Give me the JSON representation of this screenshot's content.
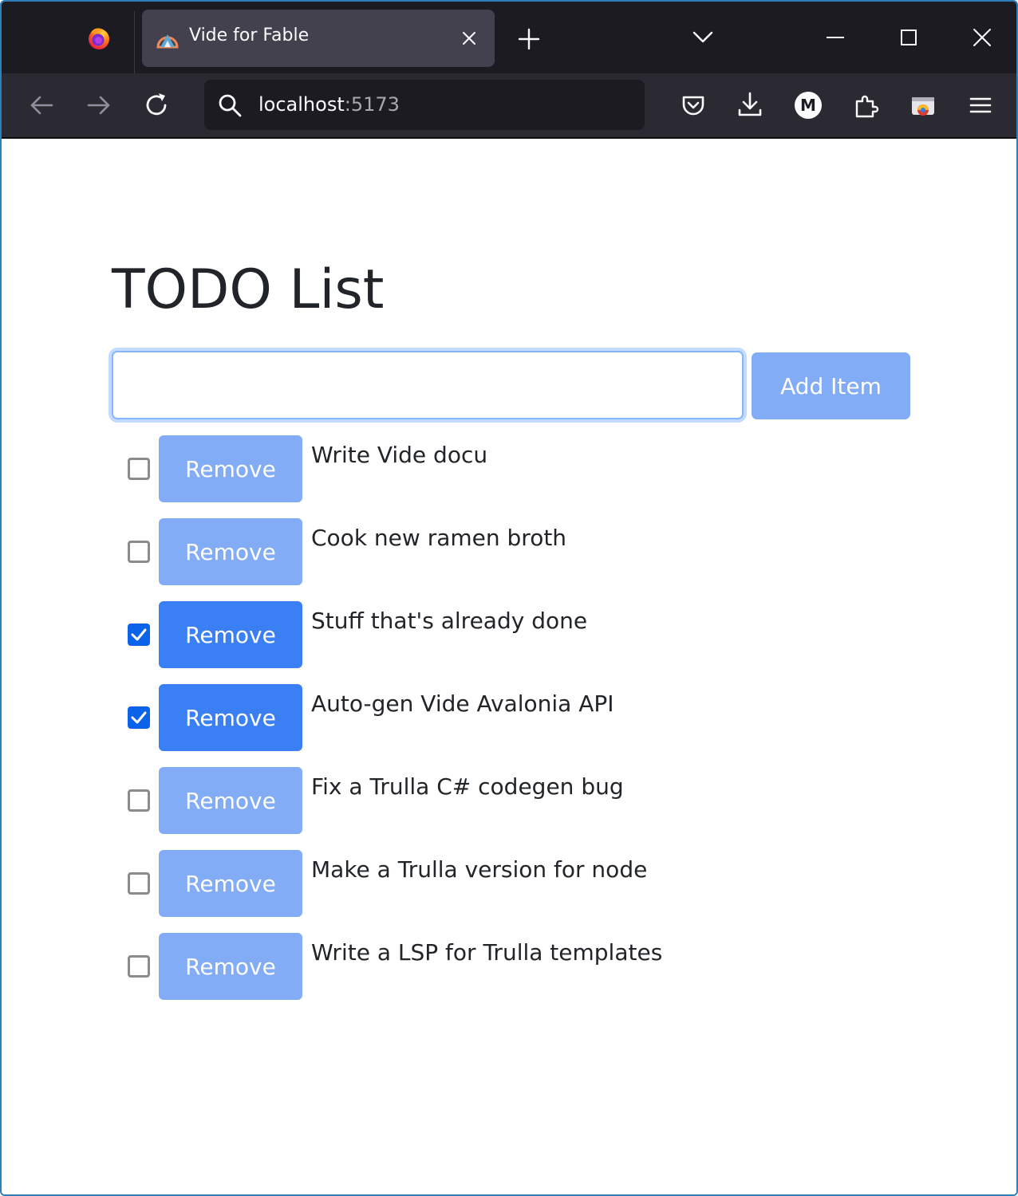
{
  "browser": {
    "tab": {
      "title": "Vide for Fable"
    },
    "url": {
      "host": "localhost",
      "port": ":5173"
    },
    "toolbar_icons": [
      "back-icon",
      "forward-icon",
      "reload-icon",
      "pocket-icon",
      "download-icon",
      "account-icon",
      "extensions-icon",
      "screenshot-icon",
      "menu-icon"
    ],
    "account_initial": "M"
  },
  "page": {
    "title": "TODO List",
    "input": {
      "value": "",
      "placeholder": ""
    },
    "add_button_label": "Add Item",
    "remove_label": "Remove",
    "items": [
      {
        "text": "Write Vide docu",
        "done": false
      },
      {
        "text": "Cook new ramen broth",
        "done": false
      },
      {
        "text": "Stuff that's already done",
        "done": true
      },
      {
        "text": "Auto-gen Vide Avalonia API",
        "done": true
      },
      {
        "text": "Fix a Trulla C# codegen bug",
        "done": false
      },
      {
        "text": "Make a Trulla version for node",
        "done": false
      },
      {
        "text": "Write a LSP for Trulla templates",
        "done": false
      }
    ]
  },
  "colors": {
    "button_primary_disabled": "#82acf6",
    "button_primary_active": "#3a80f4",
    "checkbox_checked": "#0b63ea",
    "window_border": "#2f7fb8"
  }
}
